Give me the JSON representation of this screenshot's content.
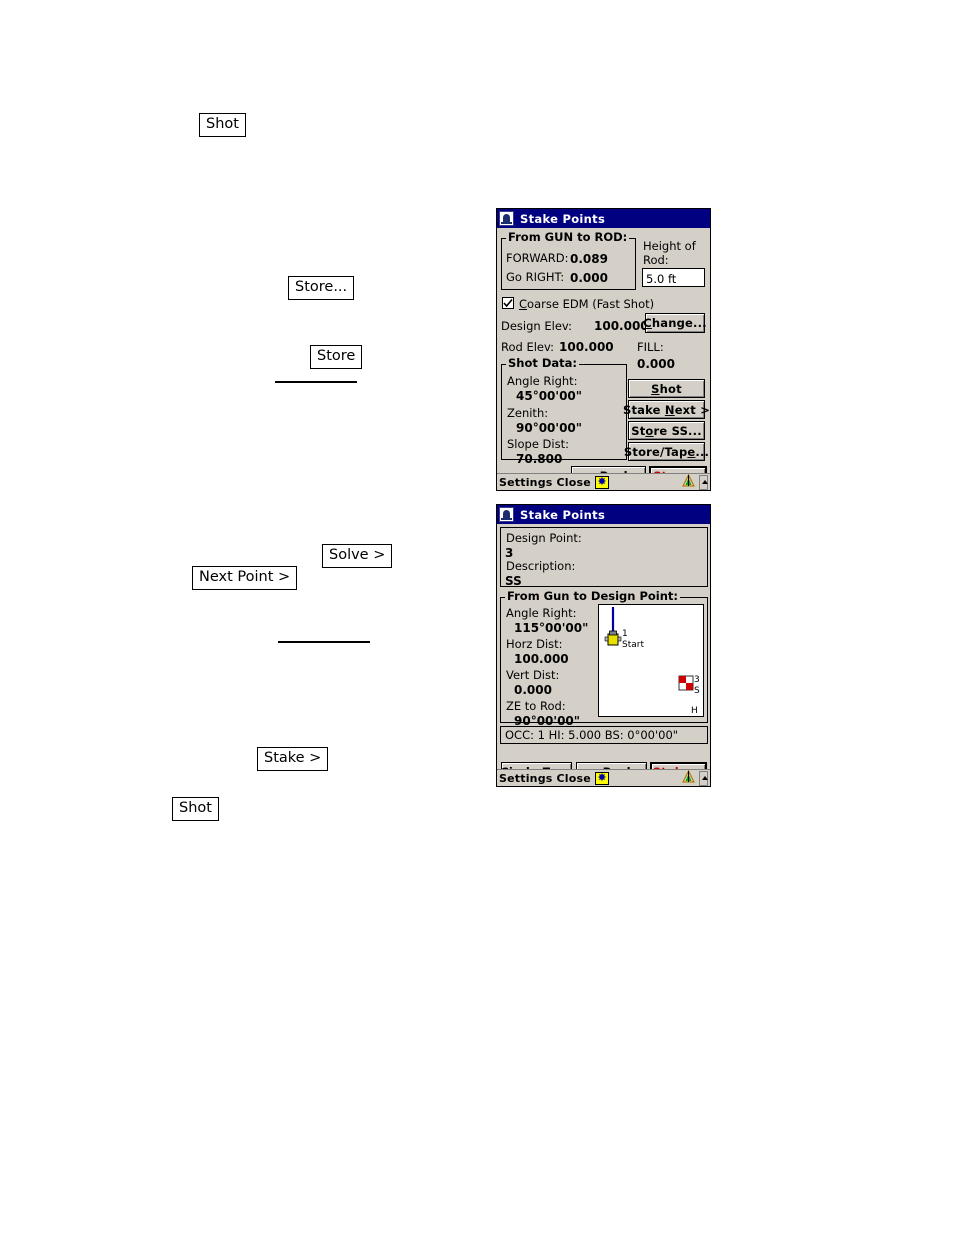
{
  "page": {
    "inline_labels": [
      {
        "id": "shot-1",
        "text": "Shot"
      },
      {
        "id": "store-ellipsis",
        "text": "Store..."
      },
      {
        "id": "store-1",
        "text": "Store"
      },
      {
        "id": "solve",
        "text": "Solve >"
      },
      {
        "id": "next-point",
        "text": "Next Point >"
      },
      {
        "id": "stake",
        "text": "Stake >"
      },
      {
        "id": "shot-2",
        "text": "Shot"
      }
    ]
  },
  "dialog1": {
    "title": "Stake Points",
    "title_icon": "stake-points-icon",
    "gun_to_rod": {
      "legend": "From GUN to ROD:",
      "forward_label": "FORWARD:",
      "forward_value": "0.089",
      "right_label": "Go RIGHT:",
      "right_value": "0.000"
    },
    "height_of_rod": {
      "label_line1": "Height of",
      "label_line2": "Rod:",
      "value": "5.0 ft"
    },
    "coarse_edm": {
      "label": "Coarse EDM (Fast Shot)",
      "accel": "C",
      "checked": true
    },
    "design_elev_label": "Design Elev:",
    "design_elev_value": "100.000",
    "change_button": "Change...",
    "change_accel": "C",
    "rod_elev_label": "Rod Elev:",
    "rod_elev_value": "100.000",
    "fill_label": "FILL:",
    "fill_value": "0.000",
    "shot_data": {
      "legend": "Shot Data:",
      "angle_right_label": "Angle Right:",
      "angle_right_value": "45°00'00\"",
      "zenith_label": "Zenith:",
      "zenith_value": "90°00'00\"",
      "slope_dist_label": "Slope Dist:",
      "slope_dist_value": "70.800"
    },
    "buttons": {
      "shot": "Shot",
      "stake_next": "Stake Next >",
      "store_ss": "Store SS...",
      "store_tape": "Store/Tape...",
      "back": "< Back",
      "store": "Store..."
    },
    "taskbar": {
      "settings": "Settings",
      "close": "Close",
      "star_icon": "star-icon",
      "survey_icon": "survey-tripod-icon",
      "scroll_icon": "scroll-up-icon"
    }
  },
  "dialog2": {
    "title": "Stake Points",
    "title_icon": "stake-points-icon",
    "design_point_label": "Design Point:",
    "design_point_value": "3",
    "description_label": "Description:",
    "description_value": "SS",
    "gun_to_design": {
      "legend": "From Gun to Design Point:",
      "angle_right_label": "Angle Right:",
      "angle_right_value": "115°00'00\"",
      "horz_dist_label": "Horz Dist:",
      "horz_dist_value": "100.000",
      "vert_dist_label": "Vert Dist:",
      "vert_dist_value": "0.000",
      "ze_to_rod_label": "ZE to Rod:",
      "ze_to_rod_value": "90°00'00\""
    },
    "map": {
      "instrument_label": "1",
      "instrument_sublabel": "Start",
      "target_label": "3",
      "target_sublabel": "S",
      "corner_label": "H",
      "line_color": "#0000a0",
      "instrument_icon": "total-station-icon",
      "target_icon": "survey-target-icon"
    },
    "status_line": "OCC: 1  HI: 5.000  BS: 0°00'00\"",
    "buttons": {
      "circle_zero": "Circle Zero",
      "back": "< Back",
      "stake": "Stake >"
    },
    "taskbar": {
      "settings": "Settings",
      "close": "Close",
      "star_icon": "star-icon",
      "survey_icon": "survey-tripod-icon",
      "scroll_icon": "scroll-up-icon"
    }
  },
  "colors": {
    "titlebar": "#000080",
    "dialog_face": "#d4d0c8",
    "accent_red": "#d00000",
    "map_line": "#0000a0"
  }
}
